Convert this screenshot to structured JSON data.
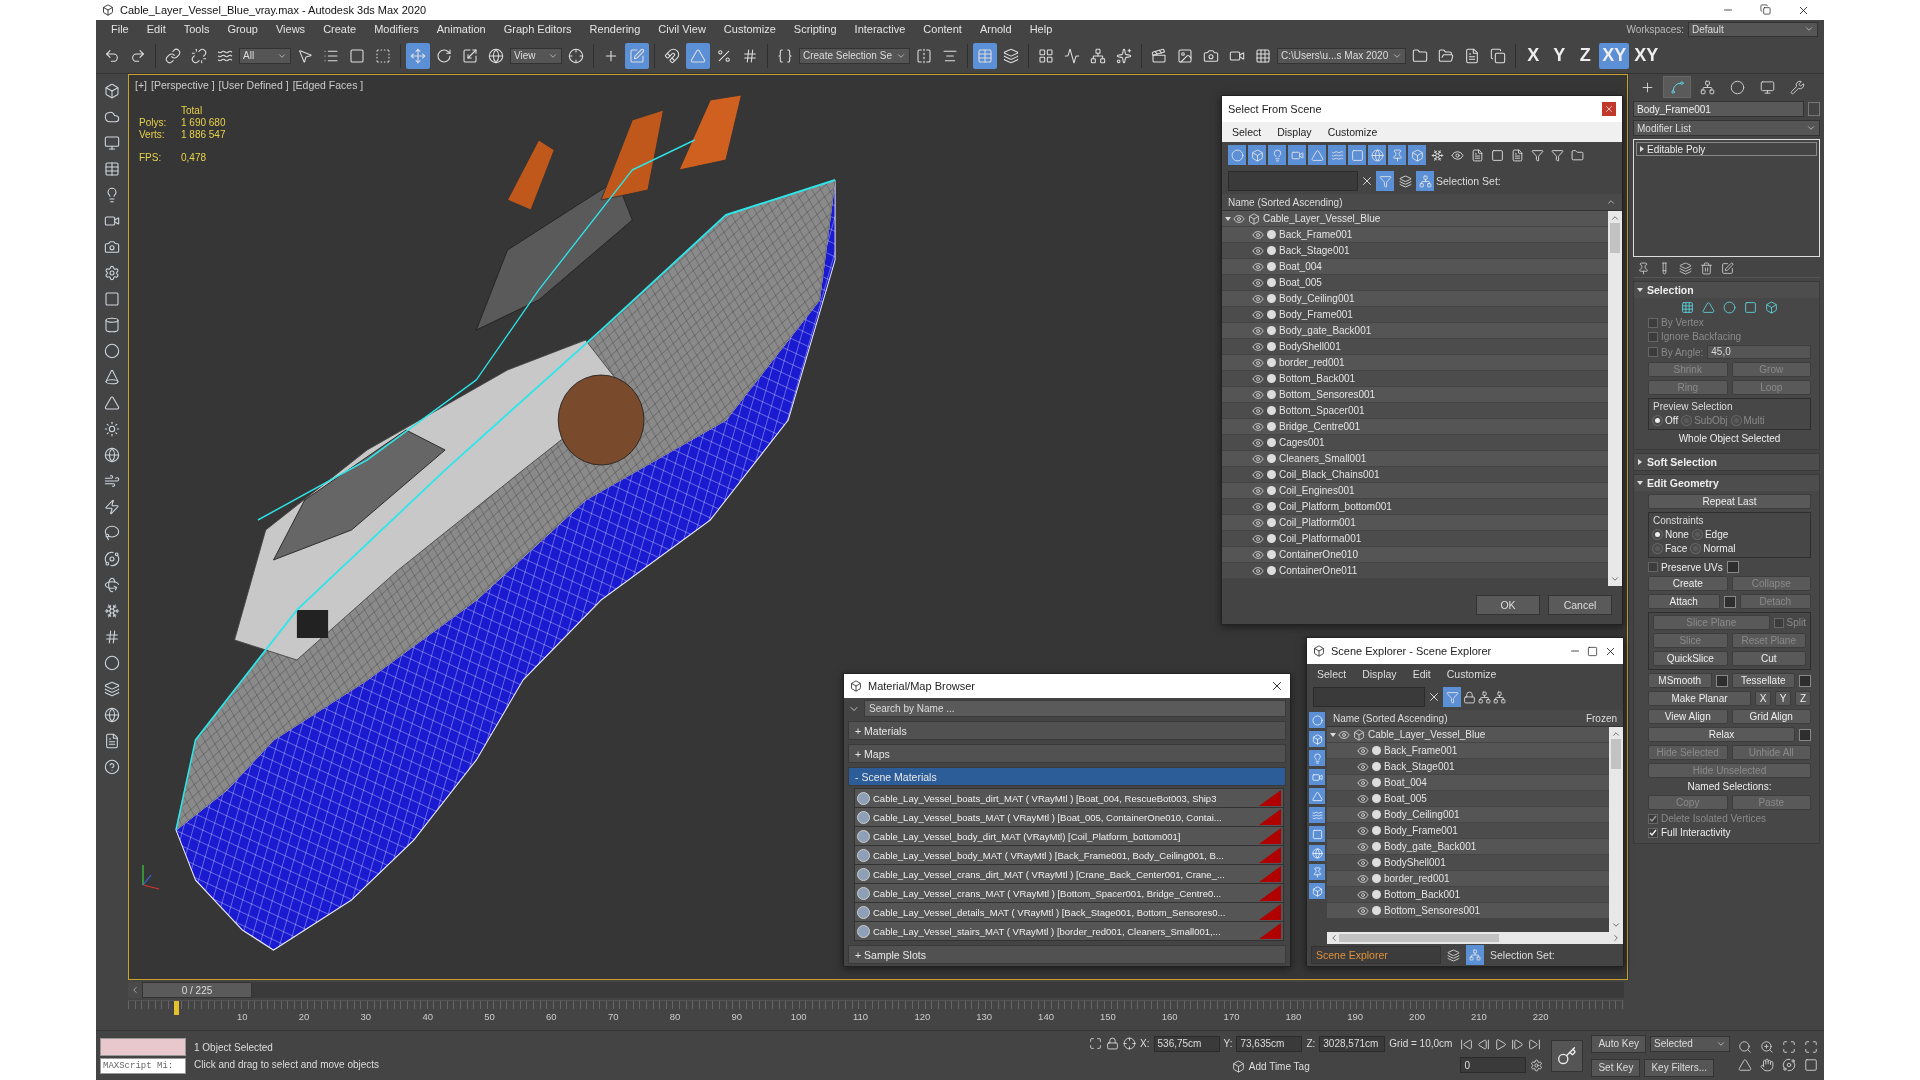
{
  "window": {
    "title": "Cable_Layer_Vessel_Blue_vray.max - Autodesk 3ds Max 2020"
  },
  "menu": [
    "File",
    "Edit",
    "Tools",
    "Group",
    "Views",
    "Create",
    "Modifiers",
    "Animation",
    "Graph Editors",
    "Rendering",
    "Civil View",
    "Customize",
    "Scripting",
    "Interactive",
    "Content",
    "Arnold",
    "Help"
  ],
  "workspace": {
    "label": "Workspaces:",
    "value": "Default"
  },
  "toolbar": {
    "selection_filter": "All",
    "reference_coord": "View",
    "named_selection": "Create Selection Se",
    "project_path": "C:\\Users\\u...s Max 2020",
    "buttons": [
      {
        "selected": false
      },
      {
        "selected": false
      },
      {
        "selected": false
      },
      {
        "selected": false
      },
      {
        "selected": false
      },
      {
        "selected": false
      },
      {
        "selected": false
      },
      {
        "selected": false
      },
      {
        "selected": false
      },
      {
        "selected": true
      },
      {
        "selected": false
      },
      {
        "selected": false
      },
      {
        "selected": false
      },
      {
        "selected": false
      },
      {
        "selected": false
      },
      {
        "selected": true
      },
      {
        "selected": false
      },
      {
        "selected": true
      },
      {
        "selected": false
      },
      {
        "selected": false
      },
      {
        "selected": false
      },
      {
        "selected": false
      },
      {
        "selected": false
      },
      {
        "selected": true
      },
      {
        "selected": false
      },
      {
        "selected": false
      },
      {
        "selected": false
      },
      {
        "selected": false
      },
      {
        "selected": false
      },
      {
        "selected": false
      },
      {
        "selected": false
      },
      {
        "selected": false
      },
      {
        "selected": false
      },
      {
        "selected": false
      },
      {
        "selected": false
      },
      {
        "selected": false
      },
      {
        "selected": false
      },
      {
        "selected": false
      }
    ],
    "axes": [
      {
        "label": "X",
        "selected": false
      },
      {
        "label": "Y",
        "selected": false
      },
      {
        "label": "Z",
        "selected": false
      },
      {
        "label": "XY",
        "selected": true
      },
      {
        "label": "XY",
        "selected": false
      }
    ]
  },
  "viewport": {
    "labels": [
      "[+]",
      "[Perspective ]",
      "[User Defined ]",
      "[Edged Faces ]"
    ],
    "stats": {
      "header": "Total",
      "rows": [
        {
          "label": "Polys:",
          "value": "1 690 680"
        },
        {
          "label": "Verts:",
          "value": "1 886 547"
        }
      ],
      "fps_label": "FPS:",
      "fps_value": "0,478"
    }
  },
  "select_from_scene": {
    "title": "Select From Scene",
    "menu": [
      "Select",
      "Display",
      "Customize"
    ],
    "selection_set_label": "Selection Set:",
    "column": "Name (Sorted Ascending)",
    "tree": [
      {
        "name": "Cable_Layer_Vessel_Blue",
        "expanded": true,
        "children": [
          {
            "name": "Back_Frame001"
          },
          {
            "name": "Back_Stage001"
          },
          {
            "name": "Boat_004"
          },
          {
            "name": "Boat_005"
          },
          {
            "name": "Body_Ceiling001"
          },
          {
            "name": "Body_Frame001"
          },
          {
            "name": "Body_gate_Back001"
          },
          {
            "name": "BodyShell001"
          },
          {
            "name": "border_red001"
          },
          {
            "name": "Bottom_Back001"
          },
          {
            "name": "Bottom_Sensores001"
          },
          {
            "name": "Bottom_Spacer001"
          },
          {
            "name": "Bridge_Centre001"
          },
          {
            "name": "Cages001"
          },
          {
            "name": "Cleaners_Small001"
          },
          {
            "name": "Coil_Black_Chains001"
          },
          {
            "name": "Coil_Engines001"
          },
          {
            "name": "Coil_Platform_bottom001"
          },
          {
            "name": "Coil_Platform001"
          },
          {
            "name": "Coil_Platforma001"
          },
          {
            "name": "ContainerOne010"
          },
          {
            "name": "ContainerOne011"
          }
        ]
      }
    ],
    "buttons": [
      "OK",
      "Cancel"
    ]
  },
  "material_browser": {
    "title": "Material/Map Browser",
    "search_placeholder": "Search by Name ...",
    "groups": [
      {
        "toggle": "+",
        "label": "Materials",
        "expanded": false
      },
      {
        "toggle": "+",
        "label": "Maps",
        "expanded": false
      },
      {
        "toggle": "-",
        "label": "Scene Materials",
        "expanded": true,
        "items": [
          "Cable_Lay_Vessel_boats_dirt_MAT ( VRayMtl ) [Boat_004, RescueBot003, Ship3",
          "Cable_Lay_Vessel_boats_MAT ( VRayMtl ) [Boat_005, ContainerOne010, Contai...",
          "Cable_Lay_Vessel_body_dirt_MAT (VRayMtl) [Coil_Platform_bottom001]",
          "Cable_Lay_Vessel_body_MAT ( VRayMtl ) [Back_Frame001, Body_Ceiling001, B...",
          "Cable_Lay_Vessel_crans_dirt_MAT ( VRayMtl ) [Crane_Back_Center001, Crane_...",
          "Cable_Lay_Vessel_crans_MAT ( VRayMtl ) [Bottom_Spacer001, Bridge_Centre0...",
          "Cable_Lay_Vessel_details_MAT ( VRayMtl ) [Back_Stage001, Bottom_Sensores0...",
          "Cable_Lay_Vessel_stairs_MAT ( VRayMtl ) [border_red001, Cleaners_Small001,..."
        ]
      },
      {
        "toggle": "+",
        "label": "Sample Slots",
        "expanded": false
      }
    ]
  },
  "scene_explorer": {
    "title": "Scene Explorer - Scene Explorer",
    "menu": [
      "Select",
      "Display",
      "Edit",
      "Customize"
    ],
    "columns": [
      "Name (Sorted Ascending)",
      "Frozen"
    ],
    "tree": [
      {
        "name": "Cable_Layer_Vessel_Blue",
        "expanded": true,
        "children": [
          {
            "name": "Back_Frame001"
          },
          {
            "name": "Back_Stage001"
          },
          {
            "name": "Boat_004"
          },
          {
            "name": "Boat_005"
          },
          {
            "name": "Body_Ceiling001"
          },
          {
            "name": "Body_Frame001"
          },
          {
            "name": "Body_gate_Back001"
          },
          {
            "name": "BodyShell001"
          },
          {
            "name": "border_red001"
          },
          {
            "name": "Bottom_Back001"
          },
          {
            "name": "Bottom_Sensores001"
          }
        ]
      }
    ],
    "explorer_name": "Scene Explorer",
    "selection_set_label": "Selection Set:"
  },
  "command_panel": {
    "tabs": [
      {
        "selected": false
      },
      {
        "selected": true
      },
      {
        "selected": false
      },
      {
        "selected": false
      },
      {
        "selected": false
      },
      {
        "selected": false
      }
    ],
    "object_name": "Body_Frame001",
    "modifier_list": "Modifier List",
    "stack": [
      {
        "label": "Editable Poly",
        "expanded": false
      }
    ],
    "rollouts": [
      {
        "title": "Selection",
        "expanded": true,
        "subobject_icons": true,
        "entries": [
          {
            "kind": "row",
            "controls": [
              {
                "kind": "checkbox",
                "label": "By Vertex",
                "checked": false,
                "disabled": true
              }
            ]
          },
          {
            "kind": "row",
            "controls": [
              {
                "kind": "checkbox",
                "label": "Ignore Backfacing",
                "checked": false,
                "disabled": true
              }
            ]
          },
          {
            "kind": "row",
            "controls": [
              {
                "kind": "checkbox",
                "label": "By Angle:",
                "checked": false,
                "disabled": true
              },
              {
                "kind": "spinner",
                "value": "45,0",
                "disabled": true
              }
            ]
          },
          {
            "kind": "row",
            "controls": [
              {
                "kind": "button",
                "label": "Shrink",
                "disabled": true
              },
              {
                "kind": "button",
                "label": "Grow",
                "disabled": true
              }
            ]
          },
          {
            "kind": "row",
            "controls": [
              {
                "kind": "button",
                "label": "Ring",
                "disabled": true
              },
              {
                "kind": "button",
                "label": "Loop",
                "disabled": true
              }
            ]
          },
          {
            "kind": "group",
            "title": "Preview Selection",
            "rows": [
              {
                "controls": [
                  {
                    "kind": "radio",
                    "label": "Off",
                    "selected": true,
                    "disabled": false
                  },
                  {
                    "kind": "radio",
                    "label": "SubObj",
                    "selected": false,
                    "disabled": true
                  },
                  {
                    "kind": "radio",
                    "label": "Multi",
                    "selected": false,
                    "disabled": true
                  }
                ]
              }
            ]
          },
          {
            "kind": "row",
            "controls": [
              {
                "kind": "text",
                "label": "Whole Object Selected"
              }
            ]
          }
        ]
      },
      {
        "title": "Soft Selection",
        "expanded": false
      },
      {
        "title": "Edit Geometry",
        "expanded": true,
        "subobject_icons": false,
        "entries": [
          {
            "kind": "row",
            "controls": [
              {
                "kind": "button",
                "label": "Repeat Last",
                "disabled": false
              }
            ]
          },
          {
            "kind": "group",
            "title": "Constraints",
            "rows": [
              {
                "controls": [
                  {
                    "kind": "radio",
                    "label": "None",
                    "selected": true,
                    "disabled": false
                  },
                  {
                    "kind": "radio",
                    "label": "Edge",
                    "selected": false,
                    "disabled": false
                  }
                ]
              },
              {
                "controls": [
                  {
                    "kind": "radio",
                    "label": "Face",
                    "selected": false,
                    "disabled": false
                  },
                  {
                    "kind": "radio",
                    "label": "Normal",
                    "selected": false,
                    "disabled": false
                  }
                ]
              }
            ]
          },
          {
            "kind": "row",
            "controls": [
              {
                "kind": "checkbox",
                "label": "Preserve UVs",
                "checked": false,
                "disabled": false
              },
              {
                "kind": "settings",
                "disabled": false
              }
            ]
          },
          {
            "kind": "row",
            "controls": [
              {
                "kind": "button",
                "label": "Create",
                "disabled": false
              },
              {
                "kind": "button",
                "label": "Collapse",
                "disabled": true
              }
            ]
          },
          {
            "kind": "row",
            "controls": [
              {
                "kind": "button",
                "label": "Attach",
                "disabled": false
              },
              {
                "kind": "settings",
                "disabled": false
              },
              {
                "kind": "button",
                "label": "Detach",
                "disabled": true
              }
            ]
          },
          {
            "kind": "group",
            "rows": [
              {
                "controls": [
                  {
                    "kind": "button",
                    "label": "Slice Plane",
                    "disabled": true
                  },
                  {
                    "kind": "checkbox",
                    "label": "Split",
                    "checked": false,
                    "disabled": true
                  }
                ]
              },
              {
                "controls": [
                  {
                    "kind": "button",
                    "label": "Slice",
                    "disabled": true
                  },
                  {
                    "kind": "button",
                    "label": "Reset Plane",
                    "disabled": true
                  }
                ]
              },
              {
                "controls": [
                  {
                    "kind": "button",
                    "label": "QuickSlice",
                    "disabled": false
                  },
                  {
                    "kind": "button",
                    "label": "Cut",
                    "disabled": false
                  }
                ]
              }
            ]
          },
          {
            "kind": "row",
            "controls": [
              {
                "kind": "button",
                "label": "MSmooth",
                "disabled": false
              },
              {
                "kind": "settings",
                "disabled": false
              },
              {
                "kind": "button",
                "label": "Tessellate",
                "disabled": false
              },
              {
                "kind": "settings",
                "disabled": false
              }
            ]
          },
          {
            "kind": "row",
            "controls": [
              {
                "kind": "button",
                "label": "Make Planar",
                "disabled": false
              },
              {
                "kind": "button",
                "label": "X",
                "disabled": false
              },
              {
                "kind": "button",
                "label": "Y",
                "disabled": false
              },
              {
                "kind": "button",
                "label": "Z",
                "disabled": false
              }
            ]
          },
          {
            "kind": "row",
            "controls": [
              {
                "kind": "button",
                "label": "View Align",
                "disabled": false
              },
              {
                "kind": "button",
                "label": "Grid Align",
                "disabled": false
              }
            ]
          },
          {
            "kind": "row",
            "controls": [
              {
                "kind": "button",
                "label": "Relax",
                "disabled": false
              },
              {
                "kind": "settings",
                "disabled": false
              }
            ]
          },
          {
            "kind": "row",
            "controls": [
              {
                "kind": "button",
                "label": "Hide Selected",
                "disabled": true
              },
              {
                "kind": "button",
                "label": "Unhide All",
                "disabled": true
              }
            ]
          },
          {
            "kind": "row",
            "controls": [
              {
                "kind": "button",
                "label": "Hide Unselected",
                "disabled": true
              }
            ]
          },
          {
            "kind": "row",
            "controls": [
              {
                "kind": "text",
                "label": "Named Selections:"
              }
            ]
          },
          {
            "kind": "row",
            "controls": [
              {
                "kind": "button",
                "label": "Copy",
                "disabled": true
              },
              {
                "kind": "button",
                "label": "Paste",
                "disabled": true
              }
            ]
          },
          {
            "kind": "row",
            "controls": [
              {
                "kind": "checkbox",
                "label": "Delete Isolated Vertices",
                "checked": true,
                "disabled": true
              }
            ]
          },
          {
            "kind": "row",
            "controls": [
              {
                "kind": "checkbox",
                "label": "Full Interactivity",
                "checked": true,
                "disabled": false
              }
            ]
          }
        ]
      }
    ]
  },
  "timeline": {
    "slider_label": "0 / 225",
    "level": 0,
    "ticks": [
      "10",
      "20",
      "30",
      "40",
      "50",
      "60",
      "70",
      "80",
      "90",
      "100",
      "110",
      "120",
      "130",
      "140",
      "150",
      "160",
      "170",
      "180",
      "190",
      "200",
      "210",
      "220"
    ]
  },
  "status_bar": {
    "listener_placeholder": "MAXScript Mi:",
    "selection": "1 Object Selected",
    "prompt": "Click and drag to select and move objects",
    "coords": [
      {
        "label": "X:",
        "value": "536,75cm"
      },
      {
        "label": "Y:",
        "value": "73,635cm"
      },
      {
        "label": "Z:",
        "value": "3028,571cm"
      }
    ],
    "grid": "Grid = 10,0cm",
    "add_time_tag": "Add Time Tag",
    "frame": "0",
    "auto_key": "Auto Key",
    "key_mode": "Selected",
    "set_key": "Set Key",
    "key_filters": "Key Filters..."
  }
}
